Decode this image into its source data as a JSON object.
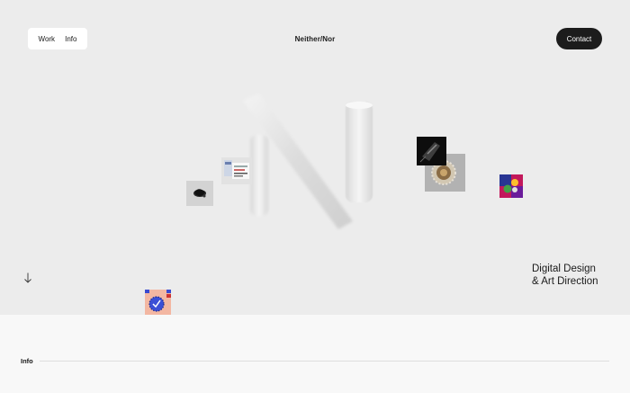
{
  "nav": {
    "work_label": "Work",
    "info_label": "Info"
  },
  "brand": {
    "name": "Neither/Nor"
  },
  "contact": {
    "label": "Contact"
  },
  "hero": {
    "tagline_line1": "Digital Design",
    "tagline_line2": "& Art Direction"
  },
  "section": {
    "info_title": "Info"
  },
  "icons": {
    "scroll": "arrow-down-icon"
  },
  "colors": {
    "background": "#ececec",
    "lower_background": "#f8f8f8",
    "button": "#1c1c1c"
  }
}
